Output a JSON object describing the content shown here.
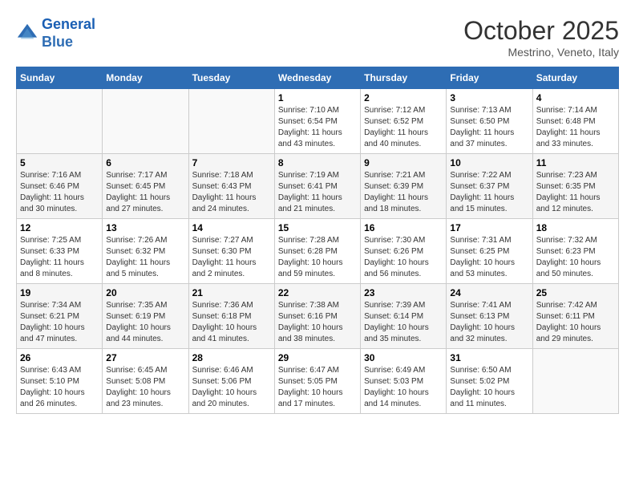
{
  "header": {
    "logo_line1": "General",
    "logo_line2": "Blue",
    "month": "October 2025",
    "location": "Mestrino, Veneto, Italy"
  },
  "weekdays": [
    "Sunday",
    "Monday",
    "Tuesday",
    "Wednesday",
    "Thursday",
    "Friday",
    "Saturday"
  ],
  "weeks": [
    [
      {
        "day": "",
        "info": ""
      },
      {
        "day": "",
        "info": ""
      },
      {
        "day": "",
        "info": ""
      },
      {
        "day": "1",
        "info": "Sunrise: 7:10 AM\nSunset: 6:54 PM\nDaylight: 11 hours and 43 minutes."
      },
      {
        "day": "2",
        "info": "Sunrise: 7:12 AM\nSunset: 6:52 PM\nDaylight: 11 hours and 40 minutes."
      },
      {
        "day": "3",
        "info": "Sunrise: 7:13 AM\nSunset: 6:50 PM\nDaylight: 11 hours and 37 minutes."
      },
      {
        "day": "4",
        "info": "Sunrise: 7:14 AM\nSunset: 6:48 PM\nDaylight: 11 hours and 33 minutes."
      }
    ],
    [
      {
        "day": "5",
        "info": "Sunrise: 7:16 AM\nSunset: 6:46 PM\nDaylight: 11 hours and 30 minutes."
      },
      {
        "day": "6",
        "info": "Sunrise: 7:17 AM\nSunset: 6:45 PM\nDaylight: 11 hours and 27 minutes."
      },
      {
        "day": "7",
        "info": "Sunrise: 7:18 AM\nSunset: 6:43 PM\nDaylight: 11 hours and 24 minutes."
      },
      {
        "day": "8",
        "info": "Sunrise: 7:19 AM\nSunset: 6:41 PM\nDaylight: 11 hours and 21 minutes."
      },
      {
        "day": "9",
        "info": "Sunrise: 7:21 AM\nSunset: 6:39 PM\nDaylight: 11 hours and 18 minutes."
      },
      {
        "day": "10",
        "info": "Sunrise: 7:22 AM\nSunset: 6:37 PM\nDaylight: 11 hours and 15 minutes."
      },
      {
        "day": "11",
        "info": "Sunrise: 7:23 AM\nSunset: 6:35 PM\nDaylight: 11 hours and 12 minutes."
      }
    ],
    [
      {
        "day": "12",
        "info": "Sunrise: 7:25 AM\nSunset: 6:33 PM\nDaylight: 11 hours and 8 minutes."
      },
      {
        "day": "13",
        "info": "Sunrise: 7:26 AM\nSunset: 6:32 PM\nDaylight: 11 hours and 5 minutes."
      },
      {
        "day": "14",
        "info": "Sunrise: 7:27 AM\nSunset: 6:30 PM\nDaylight: 11 hours and 2 minutes."
      },
      {
        "day": "15",
        "info": "Sunrise: 7:28 AM\nSunset: 6:28 PM\nDaylight: 10 hours and 59 minutes."
      },
      {
        "day": "16",
        "info": "Sunrise: 7:30 AM\nSunset: 6:26 PM\nDaylight: 10 hours and 56 minutes."
      },
      {
        "day": "17",
        "info": "Sunrise: 7:31 AM\nSunset: 6:25 PM\nDaylight: 10 hours and 53 minutes."
      },
      {
        "day": "18",
        "info": "Sunrise: 7:32 AM\nSunset: 6:23 PM\nDaylight: 10 hours and 50 minutes."
      }
    ],
    [
      {
        "day": "19",
        "info": "Sunrise: 7:34 AM\nSunset: 6:21 PM\nDaylight: 10 hours and 47 minutes."
      },
      {
        "day": "20",
        "info": "Sunrise: 7:35 AM\nSunset: 6:19 PM\nDaylight: 10 hours and 44 minutes."
      },
      {
        "day": "21",
        "info": "Sunrise: 7:36 AM\nSunset: 6:18 PM\nDaylight: 10 hours and 41 minutes."
      },
      {
        "day": "22",
        "info": "Sunrise: 7:38 AM\nSunset: 6:16 PM\nDaylight: 10 hours and 38 minutes."
      },
      {
        "day": "23",
        "info": "Sunrise: 7:39 AM\nSunset: 6:14 PM\nDaylight: 10 hours and 35 minutes."
      },
      {
        "day": "24",
        "info": "Sunrise: 7:41 AM\nSunset: 6:13 PM\nDaylight: 10 hours and 32 minutes."
      },
      {
        "day": "25",
        "info": "Sunrise: 7:42 AM\nSunset: 6:11 PM\nDaylight: 10 hours and 29 minutes."
      }
    ],
    [
      {
        "day": "26",
        "info": "Sunrise: 6:43 AM\nSunset: 5:10 PM\nDaylight: 10 hours and 26 minutes."
      },
      {
        "day": "27",
        "info": "Sunrise: 6:45 AM\nSunset: 5:08 PM\nDaylight: 10 hours and 23 minutes."
      },
      {
        "day": "28",
        "info": "Sunrise: 6:46 AM\nSunset: 5:06 PM\nDaylight: 10 hours and 20 minutes."
      },
      {
        "day": "29",
        "info": "Sunrise: 6:47 AM\nSunset: 5:05 PM\nDaylight: 10 hours and 17 minutes."
      },
      {
        "day": "30",
        "info": "Sunrise: 6:49 AM\nSunset: 5:03 PM\nDaylight: 10 hours and 14 minutes."
      },
      {
        "day": "31",
        "info": "Sunrise: 6:50 AM\nSunset: 5:02 PM\nDaylight: 10 hours and 11 minutes."
      },
      {
        "day": "",
        "info": ""
      }
    ]
  ]
}
